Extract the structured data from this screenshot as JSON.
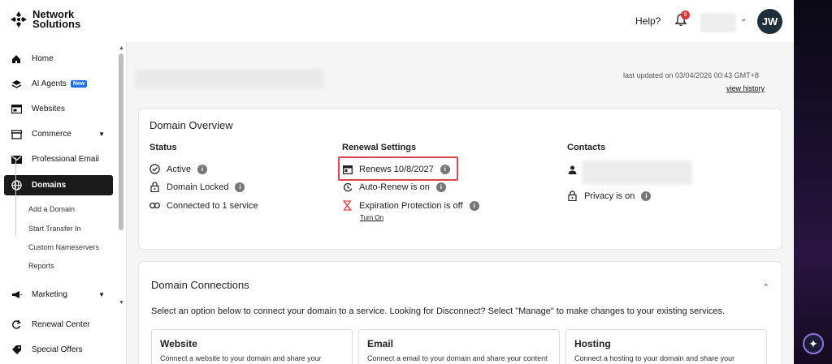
{
  "brand": {
    "name_line1": "Network",
    "name_line2": "Solutions"
  },
  "header": {
    "help_label": "Help?",
    "notifications_count": "9",
    "avatar_initials": "JW"
  },
  "sidebar": {
    "items": [
      {
        "label": "Home",
        "icon": "home-icon"
      },
      {
        "label": "AI Agents",
        "icon": "layers-icon",
        "badge": "New"
      },
      {
        "label": "Websites",
        "icon": "website-icon"
      },
      {
        "label": "Commerce",
        "icon": "store-icon"
      },
      {
        "label": "Professional Email",
        "icon": "mail-icon"
      },
      {
        "label": "Domains",
        "icon": "globe-icon"
      },
      {
        "label": "Marketing",
        "icon": "megaphone-icon"
      },
      {
        "label": "Renewal Center",
        "icon": "refresh-icon"
      },
      {
        "label": "Special Offers",
        "icon": "tag-icon"
      }
    ],
    "domain_subitems": [
      "Add a Domain",
      "Start Transfer In",
      "Custom Nameservers",
      "Reports"
    ]
  },
  "page": {
    "last_updated": "last updated on 03/04/2026 00:43 GMT+8",
    "view_history": "view history"
  },
  "overview": {
    "title": "Domain Overview",
    "status": {
      "title": "Status",
      "items": [
        "Active",
        "Domain Locked",
        "Connected to 1 service"
      ]
    },
    "renewal": {
      "title": "Renewal Settings",
      "renews": "Renews 10/8/2027",
      "auto_renew": "Auto-Renew is on",
      "expiration": "Expiration Protection is off",
      "turn_on": "Turn On"
    },
    "contacts": {
      "title": "Contacts",
      "privacy": "Privacy is on"
    }
  },
  "connections": {
    "title": "Domain Connections",
    "description": "Select an option below to connect your domain to a service. Looking for Disconnect? Select \"Manage\" to make changes to your existing services.",
    "cards": [
      {
        "title": "Website",
        "desc": "Connect a website to your domain and share your"
      },
      {
        "title": "Email",
        "desc": "Connect a email to your domain and share your content"
      },
      {
        "title": "Hosting",
        "desc": "Connect a hosting to your domain and share your"
      }
    ]
  },
  "colors": {
    "highlight": "#d9454c",
    "new_badge": "#1c6ef2",
    "active_nav": "#1a1a1a"
  }
}
